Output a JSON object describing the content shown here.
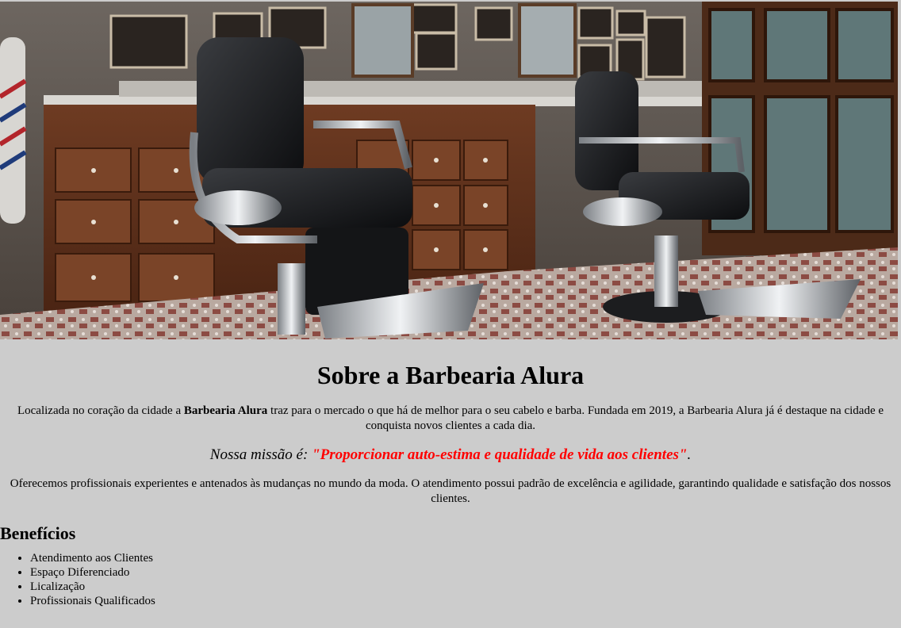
{
  "banner": {
    "alt": "Interior da Barbearia Alura com cadeiras de barbeiro"
  },
  "sobre": {
    "title": "Sobre a Barbearia Alura",
    "intro_prefix": "Localizada no coração da cidade a ",
    "intro_bold": "Barbearia Alura",
    "intro_suffix": " traz para o mercado o que há de melhor para o seu cabelo e barba. Fundada em 2019, a Barbearia Alura já é destaque na cidade e conquista novos clientes a cada dia.",
    "missao_label": "Nossa missão é: ",
    "missao_text": "\"Proporcionar auto-estima e qualidade de vida aos clientes\"",
    "missao_end": ".",
    "oferecemos": "Oferecemos profissionais experientes e antenados às mudanças no mundo da moda. O atendimento possui padrão de excelência e agilidade, garantindo qualidade e satisfação dos nossos clientes."
  },
  "beneficios": {
    "title": "Benefícios",
    "items": [
      "Atendimento aos Clientes",
      "Espaço Diferenciado",
      "Licalização",
      "Profissionais Qualificados"
    ]
  }
}
